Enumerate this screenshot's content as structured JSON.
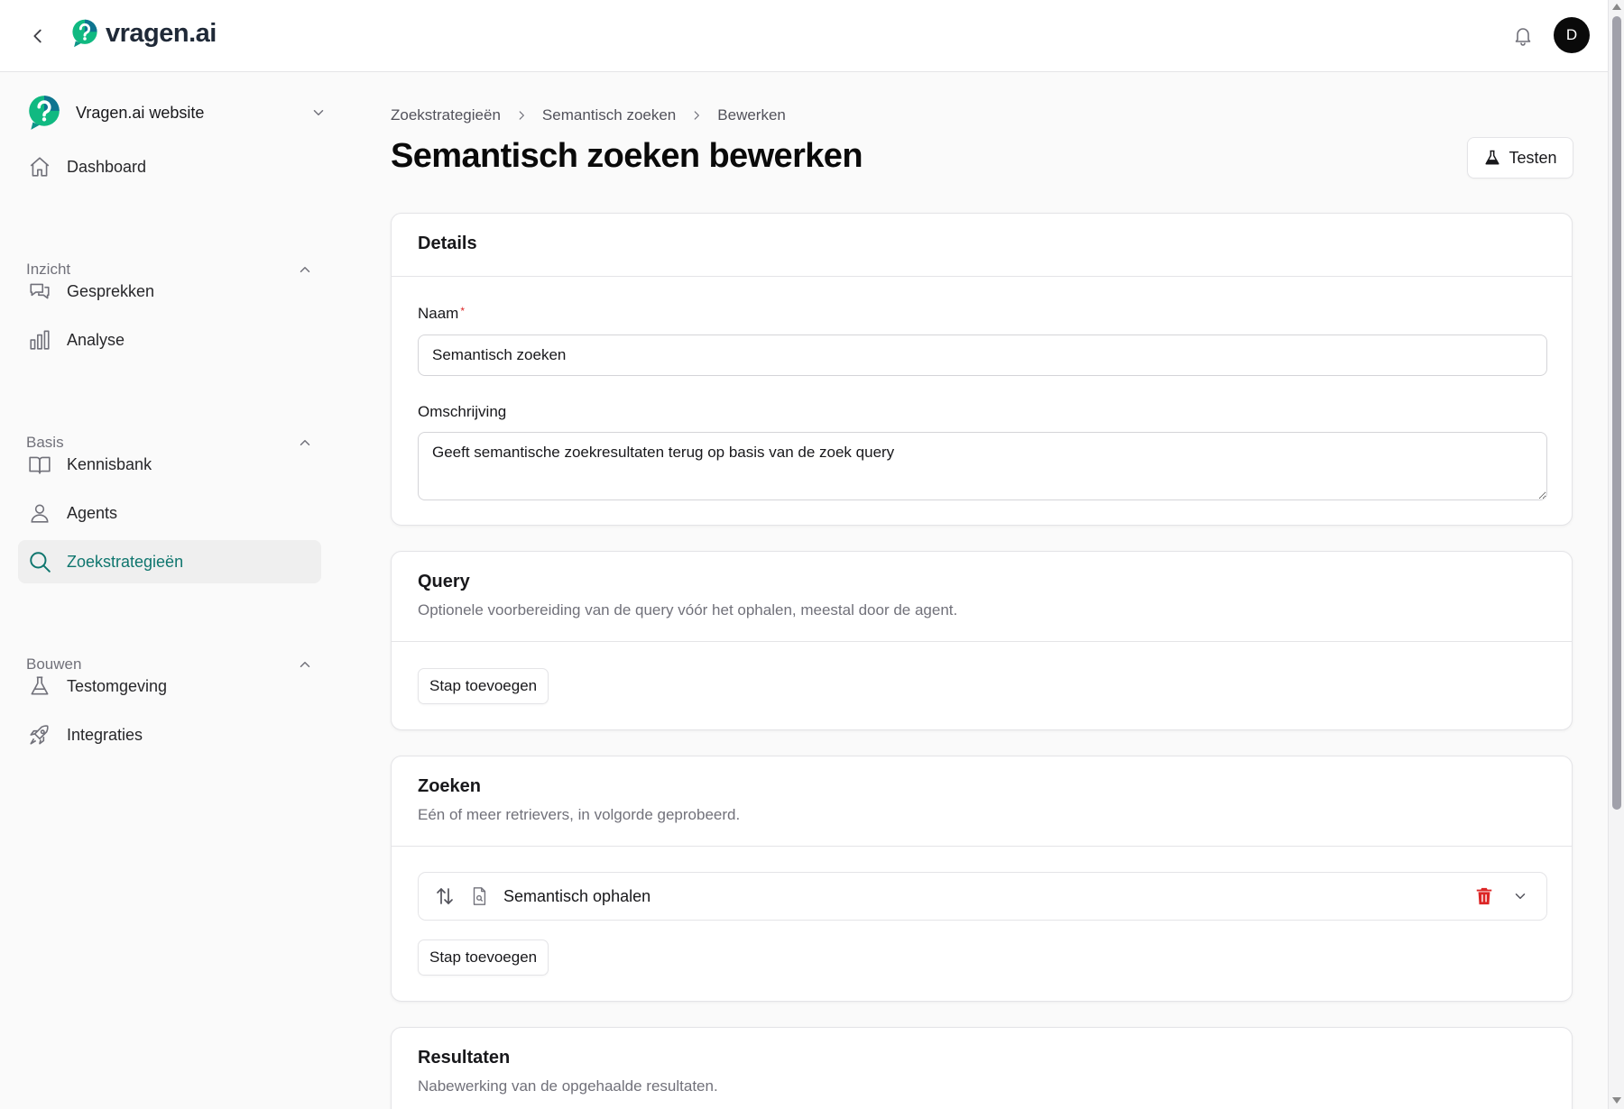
{
  "app": {
    "brand": "vragen.ai",
    "user_initial": "D"
  },
  "sidebar": {
    "workspace": "Vragen.ai website",
    "dashboard": "Dashboard",
    "sections": [
      {
        "label": "Inzicht",
        "items": [
          "Gesprekken",
          "Analyse"
        ]
      },
      {
        "label": "Basis",
        "items": [
          "Kennisbank",
          "Agents",
          "Zoekstrategieën"
        ]
      },
      {
        "label": "Bouwen",
        "items": [
          "Testomgeving",
          "Integraties"
        ]
      }
    ],
    "active_item": "Zoekstrategieën"
  },
  "breadcrumb": [
    "Zoekstrategieën",
    "Semantisch zoeken",
    "Bewerken"
  ],
  "page": {
    "title": "Semantisch zoeken bewerken",
    "test_button": "Testen"
  },
  "details": {
    "title": "Details",
    "name_label": "Naam",
    "required_mark": "*",
    "name_value": "Semantisch zoeken",
    "description_label": "Omschrijving",
    "description_value": "Geeft semantische zoekresultaten terug op basis van de zoek query"
  },
  "query": {
    "title": "Query",
    "description": "Optionele voorbereiding van de query vóór het ophalen, meestal door de agent.",
    "add_step": "Stap toevoegen"
  },
  "search": {
    "title": "Zoeken",
    "description": "Eén of meer retrievers, in volgorde geprobeerd.",
    "retriever_name": "Semantisch ophalen",
    "add_step": "Stap toevoegen"
  },
  "results": {
    "title": "Resultaten",
    "description": "Nabewerking van de opgehaalde resultaten."
  },
  "colors": {
    "accent": "#0f766e",
    "danger": "#dc2626",
    "logo_teal": "#0d9488"
  }
}
